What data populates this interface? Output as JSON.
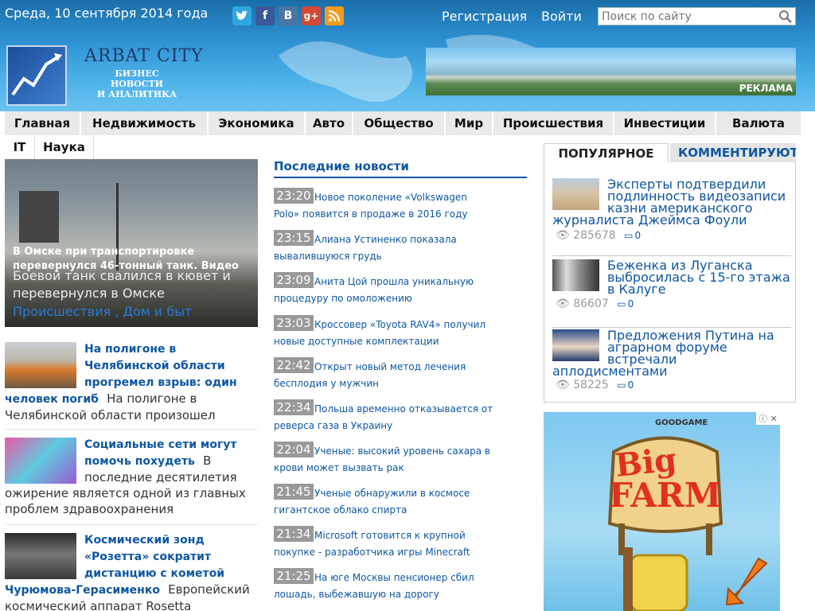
{
  "header": {
    "date": "Среда, 10 сентября 2014 года",
    "register": "Регистрация",
    "login": "Войти",
    "search_placeholder": "Поиск по сайту",
    "logo_name": "ARBAT CITY",
    "logo_sub_1": "БИЗНЕС НОВОСТИ",
    "logo_sub_2": "И АНАЛИТИКА",
    "ad_label": "РЕКЛАМА",
    "social": [
      "twitter-icon",
      "facebook-icon",
      "vk-icon",
      "google-plus-icon",
      "rss-icon"
    ]
  },
  "nav": {
    "items": [
      "Главная",
      "Недвижимость",
      "Экономика",
      "Авто",
      "Общество",
      "Мир",
      "Происшествия",
      "Инвестиции",
      "Валюта"
    ],
    "row2": [
      "IT",
      "Наука"
    ]
  },
  "hero": {
    "caption": "В Омске при транспортировке перевернулся 46-тонный танк. Видео",
    "desc": "Боевой танк свалился в кювет и перевернулся в Омске",
    "tags": "Происшествия , Дом и быт"
  },
  "left_news": [
    {
      "title": "На полигоне в Челябинской области прогремел взрыв: один человек погиб",
      "text": "На полигоне в Челябинской области произошел"
    },
    {
      "title": "Социальные сети могут помочь похудеть",
      "text": "В последние десятилетия ожирение является одной из главных проблем здравоохранения"
    },
    {
      "title": "Космический зонд «Розетта» сократит дистанцию с кометой Чурюмова-Герасименко",
      "text": "Европейский космический аппарат Rosetta"
    }
  ],
  "latest": {
    "heading": "Последние новости",
    "items": [
      {
        "time": "23:20",
        "text": "Новое поколение «Volkswagen Polo» появится в продаже в 2016 году"
      },
      {
        "time": "23:15",
        "text": "Алиана Устиненко показала вывалившуюся грудь"
      },
      {
        "time": "23:09",
        "text": "Анита Цой прошла уникальную процедуру по омоложению"
      },
      {
        "time": "23:03",
        "text": "Кроссовер «Toyota RAV4» получил новые доступные комплектации"
      },
      {
        "time": "22:42",
        "text": "Открыт новый метод лечения бесплодия у мужчин"
      },
      {
        "time": "22:34",
        "text": "Польша временно отказывается от реверса газа в Украину"
      },
      {
        "time": "22:04",
        "text": "Ученые: высокий уровень сахара в крови может вызвать рак"
      },
      {
        "time": "21:45",
        "text": "Ученые обнаружили в космосе гигантское облако спирта"
      },
      {
        "time": "21:34",
        "text": "Microsoft готовится к крупной покупке - разработчика игры Minecraft"
      },
      {
        "time": "21:25",
        "text": "На юге Москвы пенсионер сбил лошадь, выбежавшую на дорогу"
      }
    ]
  },
  "sidebar": {
    "tab_popular": "ПОПУЛЯРНОЕ",
    "tab_comments": "КОММЕНТИРУЮТ",
    "items": [
      {
        "title": "Эксперты подтвердили подлинность видеозаписи казни американского журналиста Джеймса Фоули",
        "views": "285678",
        "comments": "0"
      },
      {
        "title": "Беженка из Луганска выбросилась с 15-го этажа в Калуге",
        "views": "86607",
        "comments": "0"
      },
      {
        "title": "Предложения Путина на аграрном форуме встречали аплодисментами",
        "views": "58225",
        "comments": "0"
      }
    ]
  },
  "ad_game": {
    "brand": "GOODGAME",
    "word1": "Big",
    "word2": "FARM"
  }
}
